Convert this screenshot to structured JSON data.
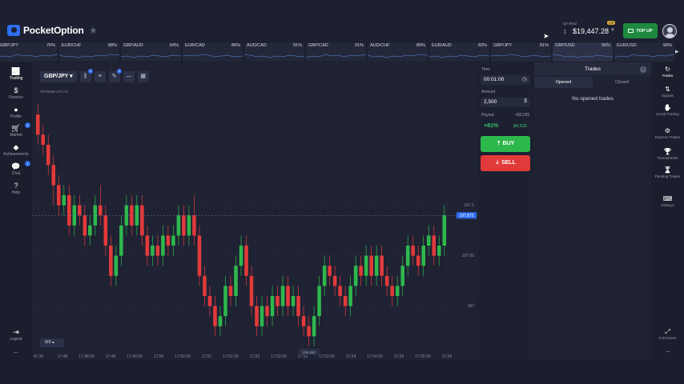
{
  "header": {
    "logo_text": "PocketOption",
    "account_type": "QT Real",
    "account_badge": "VIP",
    "balance": "$19,447.28",
    "topup_label": "TOP UP"
  },
  "ticker": {
    "items": [
      {
        "name": "GBP/JPY",
        "pct": "76%"
      },
      {
        "name": "EUR/CHF",
        "pct": "88%"
      },
      {
        "name": "GBP/AUD",
        "pct": "64%"
      },
      {
        "name": "EUR/CAD",
        "pct": "86%"
      },
      {
        "name": "AUD/CAD",
        "pct": "91%"
      },
      {
        "name": "GBP/CAD",
        "pct": "91%"
      },
      {
        "name": "AUD/CHF",
        "pct": "89%"
      },
      {
        "name": "EUR/AUD",
        "pct": "83%"
      },
      {
        "name": "GBP/JPY",
        "pct": "81%"
      },
      {
        "name": "GBP/USD",
        "pct": "56%"
      },
      {
        "name": "EUR/USD",
        "pct": "90%"
      }
    ]
  },
  "left_nav": [
    {
      "icon": "trading-icon",
      "label": "Trading"
    },
    {
      "icon": "finance-icon",
      "label": "Finance"
    },
    {
      "icon": "profile-icon",
      "label": "Profile"
    },
    {
      "icon": "market-icon",
      "label": "Market"
    },
    {
      "icon": "achievements-icon",
      "label": "Achievements"
    },
    {
      "icon": "chat-icon",
      "label": "Chat"
    },
    {
      "icon": "help-icon",
      "label": "Help"
    },
    {
      "icon": "logout-icon",
      "label": "Logout"
    }
  ],
  "chart": {
    "asset": "GBP/JPY",
    "subtitle": "XRT5836 UTC+3",
    "timeframe": "M9",
    "current_price_label": "197.872",
    "low_price_label": "196.862",
    "chart_data": {
      "type": "candlestick",
      "y_ticks": [
        "197.1",
        "197.05",
        "197"
      ],
      "x_ticks": [
        "47:30",
        "17:48",
        "17:48:30",
        "17:49",
        "17:49:30",
        "17:50",
        "17:50:30",
        "17:51",
        "17:51:30",
        "17:52",
        "17:52:30",
        "17:53",
        "17:53:30",
        "17:54",
        "17:54:30",
        "17:55",
        "17:55:30",
        "17:56"
      ],
      "price_range": [
        196.96,
        197.21
      ],
      "candles": [
        [
          197.19,
          197.17,
          197.2,
          197.16
        ],
        [
          197.17,
          197.16,
          197.18,
          197.15
        ],
        [
          197.16,
          197.14,
          197.17,
          197.13
        ],
        [
          197.14,
          197.12,
          197.15,
          197.1
        ],
        [
          197.12,
          197.1,
          197.13,
          197.09
        ],
        [
          197.1,
          197.11,
          197.12,
          197.09
        ],
        [
          197.11,
          197.08,
          197.12,
          197.07
        ],
        [
          197.08,
          197.1,
          197.11,
          197.07
        ],
        [
          197.1,
          197.09,
          197.11,
          197.08
        ],
        [
          197.09,
          197.07,
          197.1,
          197.06
        ],
        [
          197.07,
          197.08,
          197.09,
          197.06
        ],
        [
          197.08,
          197.1,
          197.11,
          197.07
        ],
        [
          197.1,
          197.09,
          197.12,
          197.08
        ],
        [
          197.09,
          197.06,
          197.1,
          197.05
        ],
        [
          197.06,
          197.03,
          197.07,
          197.02
        ],
        [
          197.03,
          197.05,
          197.06,
          197.02
        ],
        [
          197.05,
          197.08,
          197.09,
          197.04
        ],
        [
          197.08,
          197.1,
          197.11,
          197.07
        ],
        [
          197.1,
          197.08,
          197.11,
          197.07
        ],
        [
          197.08,
          197.1,
          197.11,
          197.07
        ],
        [
          197.1,
          197.07,
          197.11,
          197.06
        ],
        [
          197.07,
          197.05,
          197.08,
          197.04
        ],
        [
          197.05,
          197.06,
          197.07,
          197.04
        ],
        [
          197.06,
          197.05,
          197.07,
          197.04
        ],
        [
          197.05,
          197.07,
          197.08,
          197.04
        ],
        [
          197.07,
          197.06,
          197.08,
          197.05
        ],
        [
          197.06,
          197.07,
          197.08,
          197.05
        ],
        [
          197.07,
          197.09,
          197.1,
          197.06
        ],
        [
          197.09,
          197.07,
          197.1,
          197.06
        ],
        [
          197.07,
          197.09,
          197.1,
          197.06
        ],
        [
          197.09,
          197.07,
          197.11,
          197.06
        ],
        [
          197.07,
          197.03,
          197.08,
          197.02
        ],
        [
          197.03,
          197.01,
          197.04,
          197.0
        ],
        [
          197.01,
          197.0,
          197.02,
          196.99
        ],
        [
          197.0,
          196.98,
          197.01,
          196.97
        ],
        [
          196.98,
          196.99,
          197.0,
          196.97
        ],
        [
          196.99,
          197.02,
          197.03,
          196.98
        ],
        [
          197.02,
          197.01,
          197.03,
          197.0
        ],
        [
          197.01,
          197.04,
          197.05,
          197.0
        ],
        [
          197.04,
          197.06,
          197.07,
          197.03
        ],
        [
          197.06,
          197.03,
          197.07,
          197.02
        ],
        [
          197.03,
          197.0,
          197.04,
          196.99
        ],
        [
          197.0,
          196.98,
          197.01,
          196.97
        ],
        [
          196.98,
          197.0,
          197.01,
          196.97
        ],
        [
          197.0,
          196.99,
          197.01,
          196.98
        ],
        [
          196.99,
          197.01,
          197.02,
          196.98
        ],
        [
          197.01,
          197.0,
          197.02,
          196.99
        ],
        [
          197.0,
          197.02,
          197.03,
          196.99
        ],
        [
          197.02,
          197.0,
          197.03,
          196.99
        ],
        [
          197.0,
          197.01,
          197.02,
          196.99
        ],
        [
          197.01,
          196.99,
          197.02,
          196.98
        ],
        [
          196.99,
          196.98,
          197.0,
          196.97
        ],
        [
          196.98,
          196.97,
          196.99,
          196.96
        ],
        [
          196.97,
          196.99,
          197.0,
          196.96
        ],
        [
          196.99,
          197.02,
          197.03,
          196.98
        ],
        [
          197.02,
          197.04,
          197.05,
          197.01
        ],
        [
          197.04,
          197.03,
          197.05,
          197.02
        ],
        [
          197.03,
          197.02,
          197.04,
          197.01
        ],
        [
          197.02,
          197.01,
          197.03,
          197.0
        ],
        [
          197.01,
          197.0,
          197.02,
          196.99
        ],
        [
          197.0,
          197.02,
          197.03,
          196.99
        ],
        [
          197.02,
          197.04,
          197.05,
          197.01
        ],
        [
          197.04,
          197.03,
          197.05,
          197.02
        ],
        [
          197.03,
          197.05,
          197.06,
          197.02
        ],
        [
          197.05,
          197.03,
          197.06,
          197.02
        ],
        [
          197.03,
          197.05,
          197.06,
          197.02
        ],
        [
          197.05,
          197.03,
          197.06,
          197.02
        ],
        [
          197.03,
          197.02,
          197.04,
          197.01
        ],
        [
          197.02,
          197.01,
          197.03,
          197.0
        ],
        [
          197.01,
          197.02,
          197.03,
          197.0
        ],
        [
          197.02,
          197.04,
          197.05,
          197.01
        ],
        [
          197.04,
          197.06,
          197.07,
          197.03
        ],
        [
          197.06,
          197.05,
          197.07,
          197.04
        ],
        [
          197.05,
          197.04,
          197.06,
          197.03
        ],
        [
          197.04,
          197.06,
          197.07,
          197.03
        ],
        [
          197.06,
          197.07,
          197.08,
          197.05
        ],
        [
          197.07,
          197.05,
          197.08,
          197.04
        ],
        [
          197.05,
          197.06,
          197.07,
          197.04
        ],
        [
          197.06,
          197.09,
          197.1,
          197.05
        ]
      ],
      "grid": true
    }
  },
  "panel": {
    "time_label": "Time",
    "time_value": "00:01:00",
    "amount_label": "Amount",
    "amount_value": "2,500",
    "payout_label": "Payout",
    "payout_profit": "+$2,025",
    "payout_pct": "+81%",
    "payout_total": "$4,525",
    "buy_label": "BUY",
    "sell_label": "SELL"
  },
  "trades": {
    "title": "Trades",
    "tab_opened": "Opened",
    "tab_closed": "Closed",
    "empty_text": "No opened trades"
  },
  "right_nav": [
    {
      "icon": "trades-icon",
      "label": "Trades"
    },
    {
      "icon": "signals-icon",
      "label": "Signals"
    },
    {
      "icon": "social-trading-icon",
      "label": "Social Trading"
    },
    {
      "icon": "express-trades-icon",
      "label": "Express Trades"
    },
    {
      "icon": "tournaments-icon",
      "label": "Tournaments"
    },
    {
      "icon": "pending-trades-icon",
      "label": "Pending Trades"
    },
    {
      "icon": "hotkeys-icon",
      "label": "Hotkeys"
    },
    {
      "icon": "fullscreen-icon",
      "label": "Full screen"
    }
  ],
  "colors": {
    "up": "#2eb84c",
    "down": "#e23a3a",
    "accent": "#2e6ef2"
  }
}
